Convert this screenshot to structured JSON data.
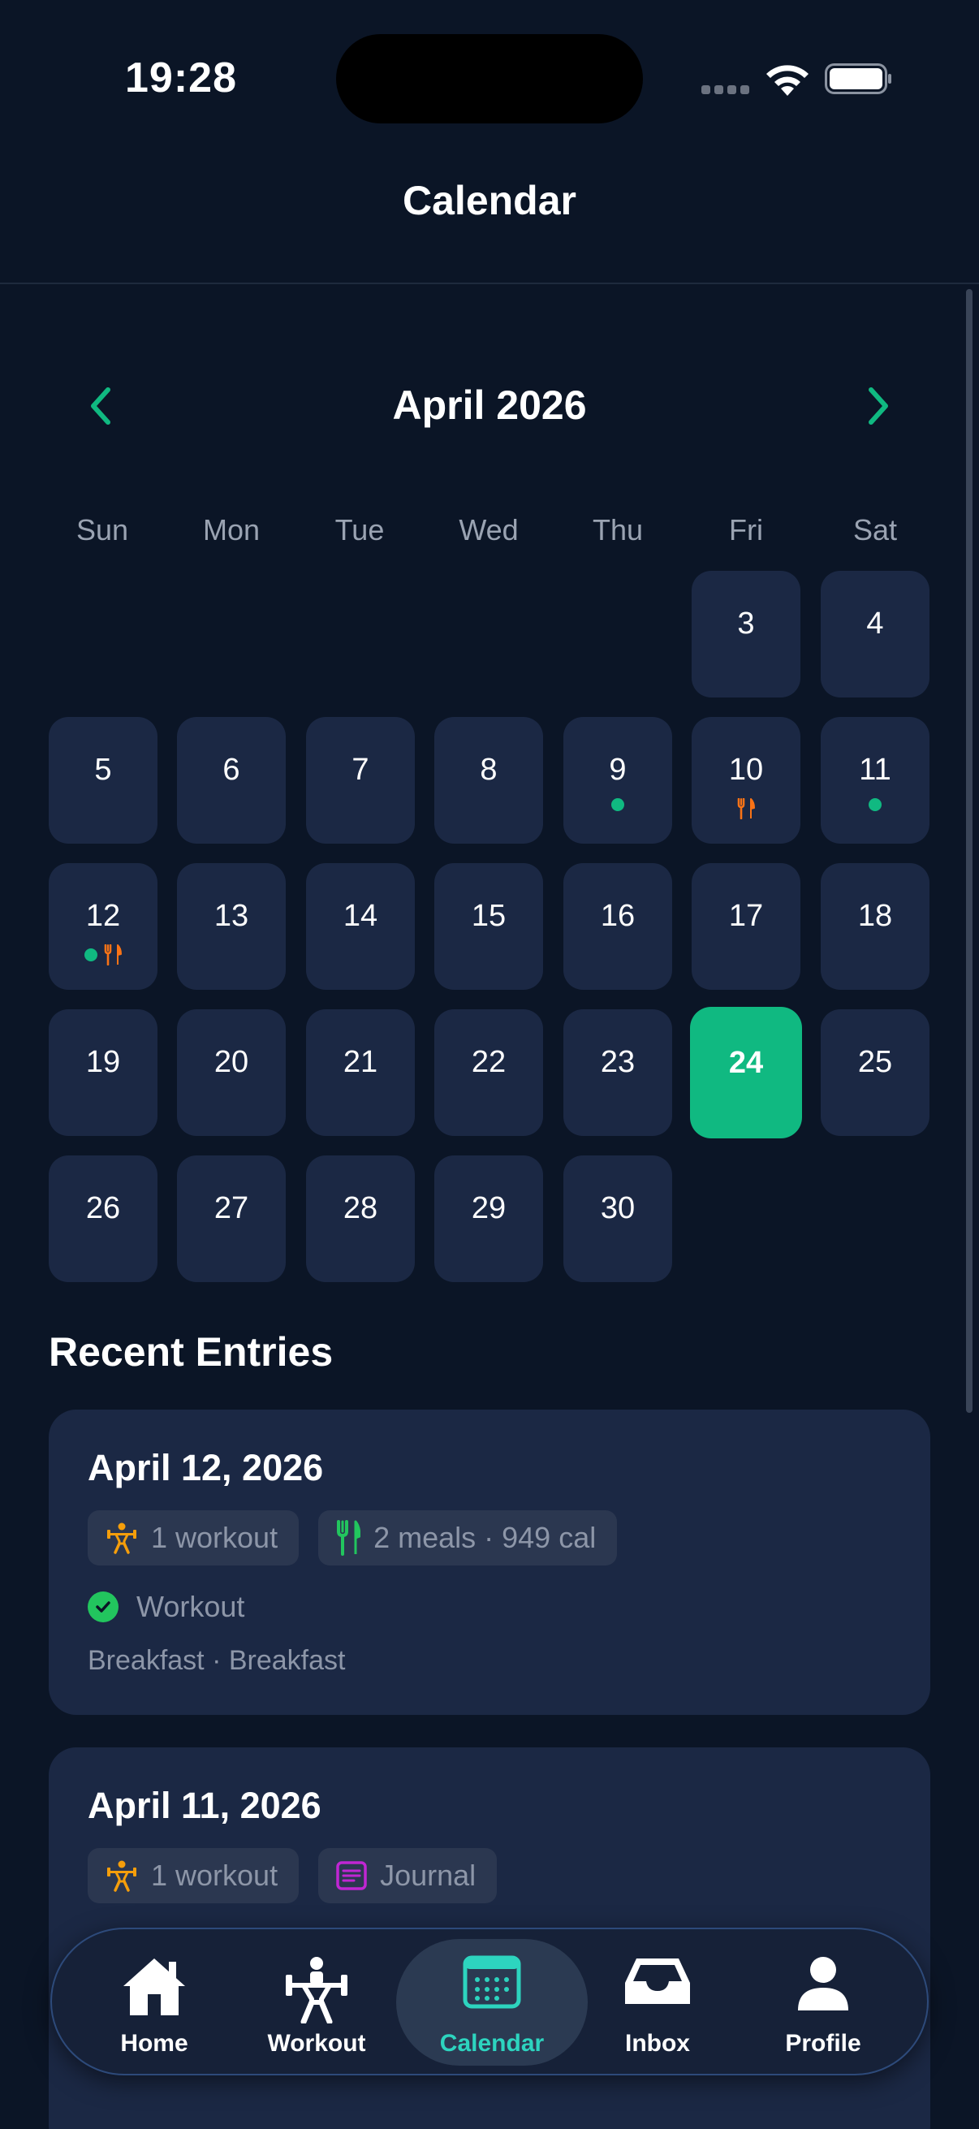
{
  "status_bar": {
    "time": "19:28"
  },
  "header": {
    "title": "Calendar"
  },
  "calendar": {
    "month_label": "April 2026",
    "weekdays": [
      "Sun",
      "Mon",
      "Tue",
      "Wed",
      "Thu",
      "Fri",
      "Sat"
    ],
    "first_weekday_index": 5,
    "selected_day": 24,
    "days": [
      "3",
      "4",
      "5",
      "6",
      "7",
      "8",
      "9",
      "10",
      "11",
      "12",
      "13",
      "14",
      "15",
      "16",
      "17",
      "18",
      "19",
      "20",
      "21",
      "22",
      "23",
      "24",
      "25",
      "26",
      "27",
      "28",
      "29",
      "30"
    ],
    "markers": {
      "9": [
        "dot"
      ],
      "10": [
        "meal"
      ],
      "11": [
        "dot"
      ],
      "12": [
        "dot",
        "meal"
      ]
    }
  },
  "recent": {
    "title": "Recent Entries",
    "entries": [
      {
        "date": "April 12, 2026",
        "chip1": "1 workout",
        "chip2": "2 meals · 949 cal",
        "status": "Workout",
        "meals": "Breakfast · Breakfast"
      },
      {
        "date": "April 11, 2026",
        "chip1": "1 workout",
        "chip2": "Journal"
      }
    ]
  },
  "tabs": {
    "home": "Home",
    "workout": "Workout",
    "calendar": "Calendar",
    "inbox": "Inbox",
    "profile": "Profile"
  },
  "colors": {
    "background": "#0b1526",
    "card": "#1b2844",
    "accent": "#10b981",
    "workout_icon": "#f59e0b",
    "meal_icon": "#22c55e",
    "journal_icon": "#c026d3",
    "active_tab": "#2dd4bf"
  }
}
